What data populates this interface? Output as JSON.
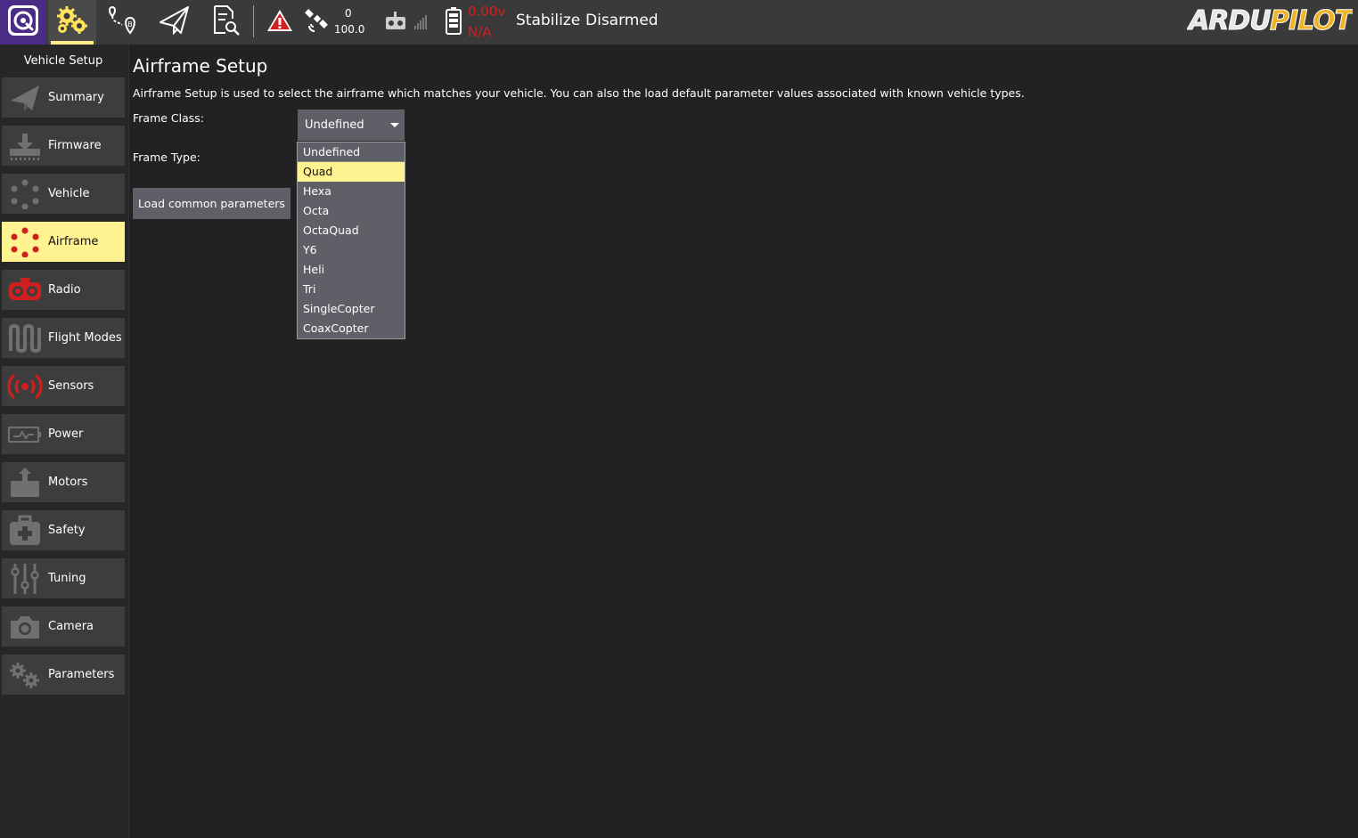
{
  "toolbar": {
    "icons": [
      "qgc-logo-icon",
      "vehicle-setup-gears-icon",
      "plan-icon",
      "fly-icon",
      "analyze-icon",
      "warning-icon",
      "gps-satellite-icon",
      "rc-transmitter-icon",
      "battery-icon"
    ],
    "gps_count": "0",
    "gps_hdop": "100.0",
    "battery_voltage": "0.00v",
    "battery_status": "N/A",
    "flight_mode": "Stabilize",
    "arm_status": "Disarmed",
    "brand_logo_text": "ARDUPILOT",
    "accent_color": "#ffeb88",
    "alert_color": "#d0201e"
  },
  "sidebar": {
    "title": "Vehicle Setup",
    "items": [
      {
        "label": "Summary",
        "icon": "summary-plane-icon"
      },
      {
        "label": "Firmware",
        "icon": "firmware-download-icon"
      },
      {
        "label": "Vehicle",
        "icon": "vehicle-frame-icon"
      },
      {
        "label": "Airframe",
        "icon": "airframe-dots-icon",
        "active": true
      },
      {
        "label": "Radio",
        "icon": "radio-transmitter-icon"
      },
      {
        "label": "Flight Modes",
        "icon": "flight-modes-wave-icon"
      },
      {
        "label": "Sensors",
        "icon": "sensors-signal-icon"
      },
      {
        "label": "Power",
        "icon": "power-battery-icon"
      },
      {
        "label": "Motors",
        "icon": "motors-icon"
      },
      {
        "label": "Safety",
        "icon": "safety-medkit-icon"
      },
      {
        "label": "Tuning",
        "icon": "tuning-sliders-icon"
      },
      {
        "label": "Camera",
        "icon": "camera-icon"
      },
      {
        "label": "Parameters",
        "icon": "parameters-gears-icon"
      }
    ],
    "active_color": "#fff291"
  },
  "main": {
    "title": "Airframe Setup",
    "description": "Airframe Setup is used to select the airframe which matches your vehicle. You can also the load default parameter values associated with known vehicle types.",
    "frame_class_label": "Frame Class:",
    "frame_type_label": "Frame Type:",
    "frame_class_value": "Undefined",
    "load_params_label": "Load common parameters",
    "frame_class_options": [
      "Undefined",
      "Quad",
      "Hexa",
      "Octa",
      "OctaQuad",
      "Y6",
      "Heli",
      "Tri",
      "SingleCopter",
      "CoaxCopter"
    ],
    "highlighted_option": "Quad"
  }
}
